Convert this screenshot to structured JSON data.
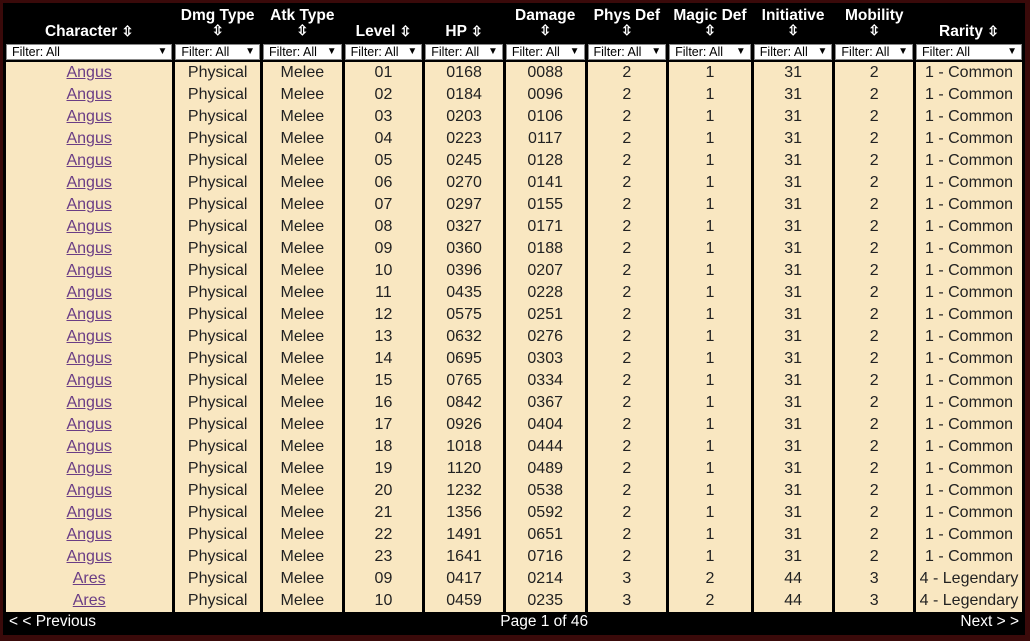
{
  "columns": [
    {
      "label": "Character",
      "filter": "Filter: All"
    },
    {
      "label": "Dmg Type",
      "filter": "Filter: All"
    },
    {
      "label": "Atk Type",
      "filter": "Filter: All"
    },
    {
      "label": "Level",
      "filter": "Filter: All"
    },
    {
      "label": "HP",
      "filter": "Filter: All"
    },
    {
      "label": "Damage",
      "filter": "Filter: All"
    },
    {
      "label": "Phys Def",
      "filter": "Filter: All"
    },
    {
      "label": "Magic Def",
      "filter": "Filter: All"
    },
    {
      "label": "Initiative",
      "filter": "Filter: All"
    },
    {
      "label": "Mobility",
      "filter": "Filter: All"
    },
    {
      "label": "Rarity",
      "filter": "Filter: All"
    }
  ],
  "sort_glyph": "⇳",
  "rows": [
    [
      "Angus",
      "Physical",
      "Melee",
      "01",
      "0168",
      "0088",
      "2",
      "1",
      "31",
      "2",
      "1 - Common"
    ],
    [
      "Angus",
      "Physical",
      "Melee",
      "02",
      "0184",
      "0096",
      "2",
      "1",
      "31",
      "2",
      "1 - Common"
    ],
    [
      "Angus",
      "Physical",
      "Melee",
      "03",
      "0203",
      "0106",
      "2",
      "1",
      "31",
      "2",
      "1 - Common"
    ],
    [
      "Angus",
      "Physical",
      "Melee",
      "04",
      "0223",
      "0117",
      "2",
      "1",
      "31",
      "2",
      "1 - Common"
    ],
    [
      "Angus",
      "Physical",
      "Melee",
      "05",
      "0245",
      "0128",
      "2",
      "1",
      "31",
      "2",
      "1 - Common"
    ],
    [
      "Angus",
      "Physical",
      "Melee",
      "06",
      "0270",
      "0141",
      "2",
      "1",
      "31",
      "2",
      "1 - Common"
    ],
    [
      "Angus",
      "Physical",
      "Melee",
      "07",
      "0297",
      "0155",
      "2",
      "1",
      "31",
      "2",
      "1 - Common"
    ],
    [
      "Angus",
      "Physical",
      "Melee",
      "08",
      "0327",
      "0171",
      "2",
      "1",
      "31",
      "2",
      "1 - Common"
    ],
    [
      "Angus",
      "Physical",
      "Melee",
      "09",
      "0360",
      "0188",
      "2",
      "1",
      "31",
      "2",
      "1 - Common"
    ],
    [
      "Angus",
      "Physical",
      "Melee",
      "10",
      "0396",
      "0207",
      "2",
      "1",
      "31",
      "2",
      "1 - Common"
    ],
    [
      "Angus",
      "Physical",
      "Melee",
      "11",
      "0435",
      "0228",
      "2",
      "1",
      "31",
      "2",
      "1 - Common"
    ],
    [
      "Angus",
      "Physical",
      "Melee",
      "12",
      "0575",
      "0251",
      "2",
      "1",
      "31",
      "2",
      "1 - Common"
    ],
    [
      "Angus",
      "Physical",
      "Melee",
      "13",
      "0632",
      "0276",
      "2",
      "1",
      "31",
      "2",
      "1 - Common"
    ],
    [
      "Angus",
      "Physical",
      "Melee",
      "14",
      "0695",
      "0303",
      "2",
      "1",
      "31",
      "2",
      "1 - Common"
    ],
    [
      "Angus",
      "Physical",
      "Melee",
      "15",
      "0765",
      "0334",
      "2",
      "1",
      "31",
      "2",
      "1 - Common"
    ],
    [
      "Angus",
      "Physical",
      "Melee",
      "16",
      "0842",
      "0367",
      "2",
      "1",
      "31",
      "2",
      "1 - Common"
    ],
    [
      "Angus",
      "Physical",
      "Melee",
      "17",
      "0926",
      "0404",
      "2",
      "1",
      "31",
      "2",
      "1 - Common"
    ],
    [
      "Angus",
      "Physical",
      "Melee",
      "18",
      "1018",
      "0444",
      "2",
      "1",
      "31",
      "2",
      "1 - Common"
    ],
    [
      "Angus",
      "Physical",
      "Melee",
      "19",
      "1120",
      "0489",
      "2",
      "1",
      "31",
      "2",
      "1 - Common"
    ],
    [
      "Angus",
      "Physical",
      "Melee",
      "20",
      "1232",
      "0538",
      "2",
      "1",
      "31",
      "2",
      "1 - Common"
    ],
    [
      "Angus",
      "Physical",
      "Melee",
      "21",
      "1356",
      "0592",
      "2",
      "1",
      "31",
      "2",
      "1 - Common"
    ],
    [
      "Angus",
      "Physical",
      "Melee",
      "22",
      "1491",
      "0651",
      "2",
      "1",
      "31",
      "2",
      "1 - Common"
    ],
    [
      "Angus",
      "Physical",
      "Melee",
      "23",
      "1641",
      "0716",
      "2",
      "1",
      "31",
      "2",
      "1 - Common"
    ],
    [
      "Ares",
      "Physical",
      "Melee",
      "09",
      "0417",
      "0214",
      "3",
      "2",
      "44",
      "3",
      "4 - Legendary"
    ],
    [
      "Ares",
      "Physical",
      "Melee",
      "10",
      "0459",
      "0235",
      "3",
      "2",
      "44",
      "3",
      "4 - Legendary"
    ]
  ],
  "pager": {
    "prev": "< < Previous",
    "page": "Page 1 of 46",
    "next": "Next > >"
  },
  "colors": {
    "row_bg": "#f9e7c1",
    "header_bg": "#000000",
    "link": "#6a3d85"
  }
}
